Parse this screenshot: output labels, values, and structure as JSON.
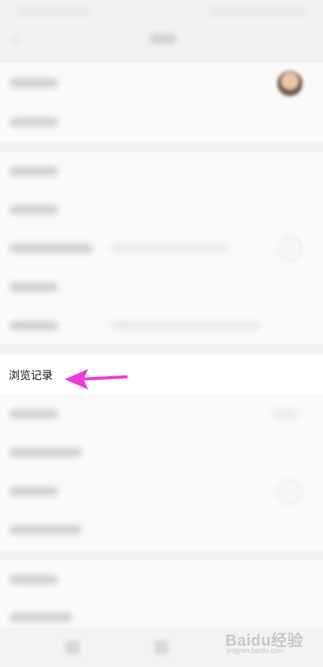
{
  "header": {
    "title": "设置",
    "back_icon": "back-arrow-icon"
  },
  "settings": {
    "highlighted_item": {
      "label": "浏览记录"
    }
  },
  "annotation": {
    "arrow_color": "#f03bd6"
  },
  "watermark": {
    "text": "Baidu经验",
    "url": "jingyan.baidu.com"
  }
}
